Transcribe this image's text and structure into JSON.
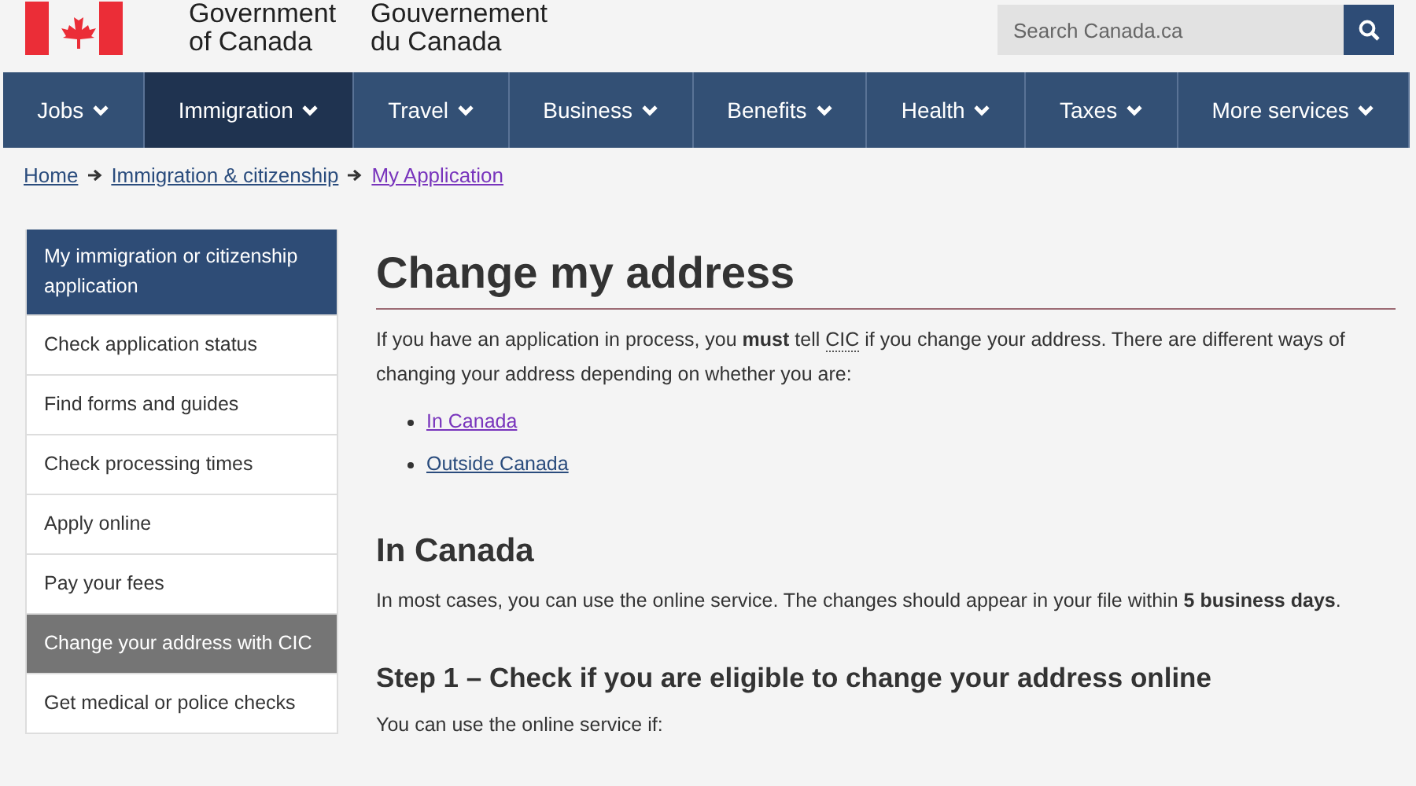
{
  "header": {
    "signature_en": [
      "Government",
      "of Canada"
    ],
    "signature_fr": [
      "Gouvernement",
      "du Canada"
    ],
    "search": {
      "placeholder": "Search Canada.ca"
    }
  },
  "nav": [
    {
      "label": "Jobs",
      "selected": false
    },
    {
      "label": "Immigration",
      "selected": true
    },
    {
      "label": "Travel",
      "selected": false
    },
    {
      "label": "Business",
      "selected": false
    },
    {
      "label": "Benefits",
      "selected": false
    },
    {
      "label": "Health",
      "selected": false
    },
    {
      "label": "Taxes",
      "selected": false
    },
    {
      "label": "More services",
      "selected": false
    }
  ],
  "breadcrumb": [
    {
      "label": "Home",
      "visited": false
    },
    {
      "label": "Immigration & citizenship",
      "visited": false
    },
    {
      "label": "My Application",
      "visited": true
    }
  ],
  "sidebar": [
    {
      "label": "My immigration or citizenship application",
      "kind": "heading"
    },
    {
      "label": "Check application status",
      "kind": "link",
      "selected": false
    },
    {
      "label": "Find forms and guides",
      "kind": "link",
      "selected": false
    },
    {
      "label": "Check processing times",
      "kind": "link",
      "selected": false
    },
    {
      "label": "Apply online",
      "kind": "link",
      "selected": false
    },
    {
      "label": "Pay your fees",
      "kind": "link",
      "selected": false
    },
    {
      "label": "Change your address with CIC",
      "kind": "link",
      "selected": true
    },
    {
      "label": "Get medical or police checks",
      "kind": "link",
      "selected": false
    }
  ],
  "main": {
    "title": "Change my address",
    "intro": [
      {
        "text": "If you have an application in process, you ",
        "kind": "plain"
      },
      {
        "text": "must",
        "kind": "bold"
      },
      {
        "text": " tell ",
        "kind": "plain"
      },
      {
        "text": "CIC",
        "kind": "abbr"
      },
      {
        "text": " if you change your address. There are different ways of changing your address depending on whether you are:",
        "kind": "plain"
      }
    ],
    "links": [
      {
        "label": "In Canada",
        "visited": true
      },
      {
        "label": "Outside Canada",
        "visited": false
      }
    ],
    "section_title": "In Canada",
    "section_text": "In most cases, you can use the online service. The changes should appear in your file within **5 business days**.",
    "step_title": "Step 1 – Check if you are eligible to change your address online",
    "step_text": "You can use the online service if:"
  }
}
